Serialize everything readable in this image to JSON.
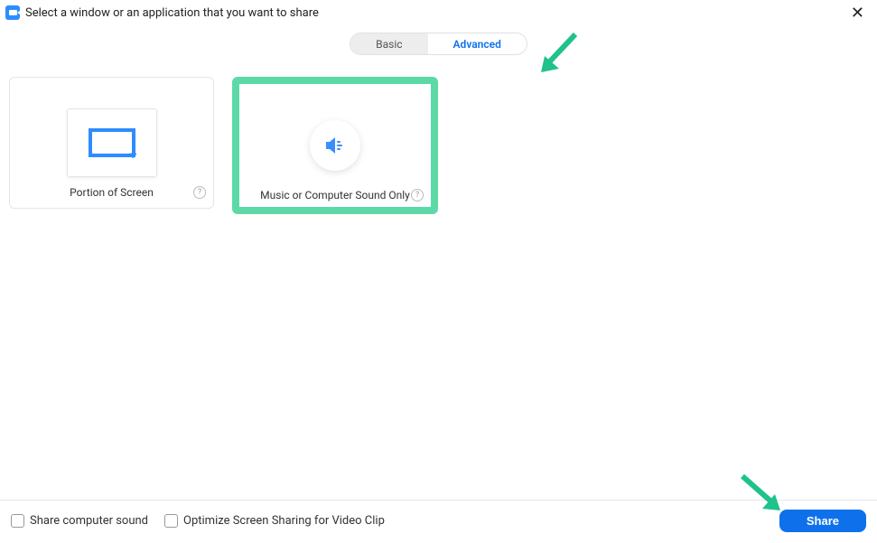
{
  "header": {
    "title": "Select a window or an application that you want to share"
  },
  "tabs": {
    "basic": "Basic",
    "advanced": "Advanced"
  },
  "cards": {
    "portion": {
      "label": "Portion of Screen"
    },
    "sound": {
      "label": "Music or Computer Sound Only"
    }
  },
  "footer": {
    "share_sound": "Share computer sound",
    "optimize": "Optimize Screen Sharing for Video Clip",
    "share_btn": "Share"
  }
}
